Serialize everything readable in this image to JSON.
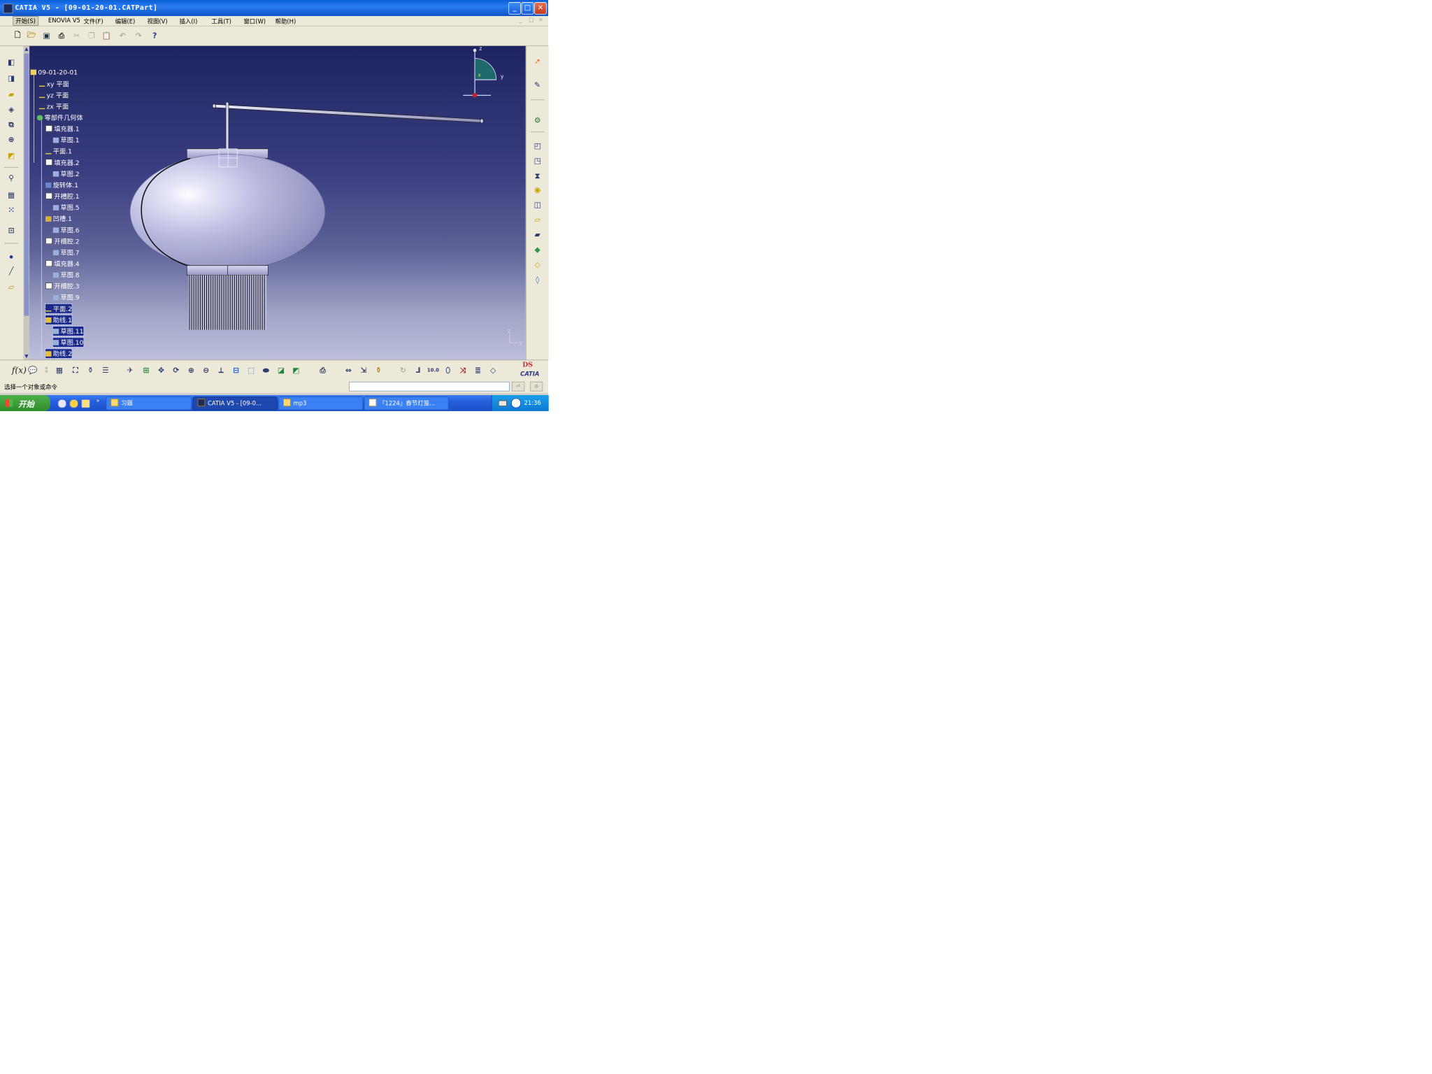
{
  "window": {
    "title": "CATIA V5 - [09-01-20-01.CATPart]",
    "minimize": "_",
    "maximize": "□",
    "close": "✕"
  },
  "menu": {
    "items": [
      "开始(S)",
      "ENOVIA V5",
      "文件(F)",
      "编辑(E)",
      "视图(V)",
      "插入(I)",
      "工具(T)",
      "窗口(W)",
      "帮助(H)"
    ],
    "mdi": [
      "_",
      "□",
      "×"
    ]
  },
  "standard_toolbar": [
    "new-icon",
    "open-icon",
    "save-icon",
    "print-icon",
    "cut-icon",
    "copy-icon",
    "paste-icon",
    "undo-icon",
    "redo-icon",
    "whats-this-icon"
  ],
  "tree": {
    "root": "09-01-20-01",
    "planes": [
      "xy 平面",
      "yz 平面",
      "zx 平面"
    ],
    "body": "零部件几何体",
    "features": [
      {
        "label": "填充器.1",
        "selected": false
      },
      {
        "label": "草图.1",
        "selected": false
      },
      {
        "label": "平面.1",
        "selected": false
      },
      {
        "label": "填充器.2",
        "selected": false
      },
      {
        "label": "草图.2",
        "selected": false
      },
      {
        "label": "旋转体.1",
        "selected": false
      },
      {
        "label": "开槽腔.1",
        "selected": false
      },
      {
        "label": "草图.5",
        "selected": false
      },
      {
        "label": "凹槽.1",
        "selected": false
      },
      {
        "label": "草图.6",
        "selected": false
      },
      {
        "label": "开槽腔.2",
        "selected": false
      },
      {
        "label": "草图.7",
        "selected": false
      },
      {
        "label": "填充器.4",
        "selected": false
      },
      {
        "label": "草图.8",
        "selected": false
      },
      {
        "label": "开槽腔.3",
        "selected": false
      },
      {
        "label": "草图.9",
        "selected": false
      },
      {
        "label": "平面.2",
        "selected": true
      },
      {
        "label": "助线.1",
        "selected": true
      },
      {
        "label": "草图.11",
        "selected": true
      },
      {
        "label": "草图.10",
        "selected": true
      },
      {
        "label": "助线.2",
        "selected": true
      }
    ]
  },
  "compass": {
    "z": "z",
    "y": "y",
    "x": "x"
  },
  "axis_indicator": {
    "z": "z",
    "y": "y"
  },
  "bottom_toolbar": {
    "fx_label": "f(x)"
  },
  "branding": {
    "ds": "DS",
    "catia": "CATIA"
  },
  "status": {
    "text": "选择一个对象或命令",
    "command_value": ""
  },
  "taskbar": {
    "start": "开始",
    "tasks": [
      "习题",
      "CATIA V5 - [09-0...",
      "mp3",
      "『1224』春节灯笼..."
    ],
    "clock": "21:36"
  },
  "colors": {
    "viewport_top": "#1e2460",
    "viewport_bottom": "#bdc0da",
    "title_blue": "#0a5fd8",
    "selection": "#1a2a8a",
    "lantern_body": "#c8c9ea"
  }
}
